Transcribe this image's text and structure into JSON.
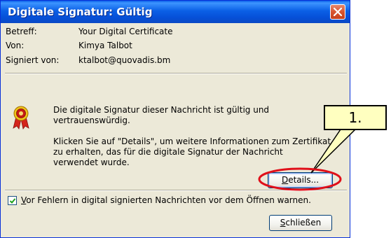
{
  "window": {
    "title": "Digitale Signatur: Gültig"
  },
  "info": {
    "rows": [
      {
        "label": "Betreff:",
        "value": "Your Digital Certificate"
      },
      {
        "label": "Von:",
        "value": "Kimya Talbot"
      },
      {
        "label": "Signiert von:",
        "value": "ktalbot@quovadis.bm"
      }
    ]
  },
  "message": {
    "line1": "Die digitale Signatur dieser Nachricht ist gültig und",
    "line2": "vertrauenswürdig.",
    "details_line1": "Klicken Sie auf \"Details\", um weitere Informationen zum Zertifikat",
    "details_line2": "zu erhalten, das für die digitale Signatur der Nachricht",
    "details_line3": "verwendet wurde."
  },
  "buttons": {
    "details_mnemonic": "D",
    "details_rest": "etails...",
    "close_mnemonic": "S",
    "close_rest": "chließen"
  },
  "checkbox": {
    "checked": true,
    "label_mnemonic": "V",
    "label_rest": "or Fehlern in digital signierten Nachrichten vor dem Öffnen warnen."
  },
  "annotation": {
    "callout_text": "1."
  },
  "colors": {
    "titlebar": "#0a5fe8",
    "dialog_bg": "#ece9d8",
    "callout_bg": "#ffffc0",
    "highlight_ring": "#e0101a",
    "close_button": "#d8542f"
  },
  "icons": {
    "seal": "certificate-seal-icon",
    "close": "close-x-icon",
    "check": "checkmark-icon"
  }
}
